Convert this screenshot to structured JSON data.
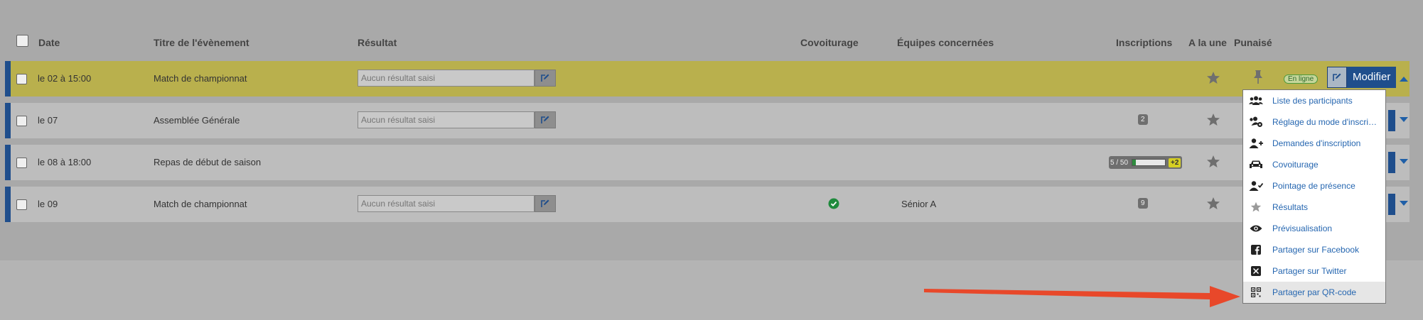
{
  "colors": {
    "accent": "#1f4e8c",
    "selected_row": "#b9b04d",
    "link": "#2566b0",
    "arrow": "#e8482a"
  },
  "header": {
    "date": "Date",
    "title": "Titre de l'évènement",
    "result": "Résultat",
    "carpool": "Covoiturage",
    "teams": "Équipes concernées",
    "registrations": "Inscriptions",
    "featured": "A la une",
    "pinned": "Punaisé"
  },
  "rows": [
    {
      "date": "le 02 à 15:00",
      "title": "Match de championnat",
      "result_placeholder": "Aucun résultat saisi",
      "status": "En ligne",
      "modify": "Modifier"
    },
    {
      "date": "le 07",
      "title": "Assemblée Générale",
      "result_placeholder": "Aucun résultat saisi",
      "registrations": "2"
    },
    {
      "date": "le 08 à 18:00",
      "title": "Repas de début de saison",
      "registrations": "5 / 50",
      "registrations_fill": 0.1,
      "extra": "+2"
    },
    {
      "date": "le 09",
      "title": "Match de championnat",
      "result_placeholder": "Aucun résultat saisi",
      "team": "Sénior A",
      "registrations": "9"
    }
  ],
  "menu": [
    {
      "label": "Liste des participants",
      "icon": "users-icon"
    },
    {
      "label": "Réglage du mode d'inscri…",
      "icon": "users-gear-icon"
    },
    {
      "label": "Demandes d'inscription",
      "icon": "user-plus-icon"
    },
    {
      "label": "Covoiturage",
      "icon": "car-icon"
    },
    {
      "label": "Pointage de présence",
      "icon": "user-check-icon"
    },
    {
      "label": "Résultats",
      "icon": "star-icon"
    },
    {
      "label": "Prévisualisation",
      "icon": "eye-icon"
    },
    {
      "label": "Partager sur Facebook",
      "icon": "facebook-icon"
    },
    {
      "label": "Partager sur Twitter",
      "icon": "x-twitter-icon"
    },
    {
      "label": "Partager par QR-code",
      "icon": "qr-code-icon"
    }
  ]
}
